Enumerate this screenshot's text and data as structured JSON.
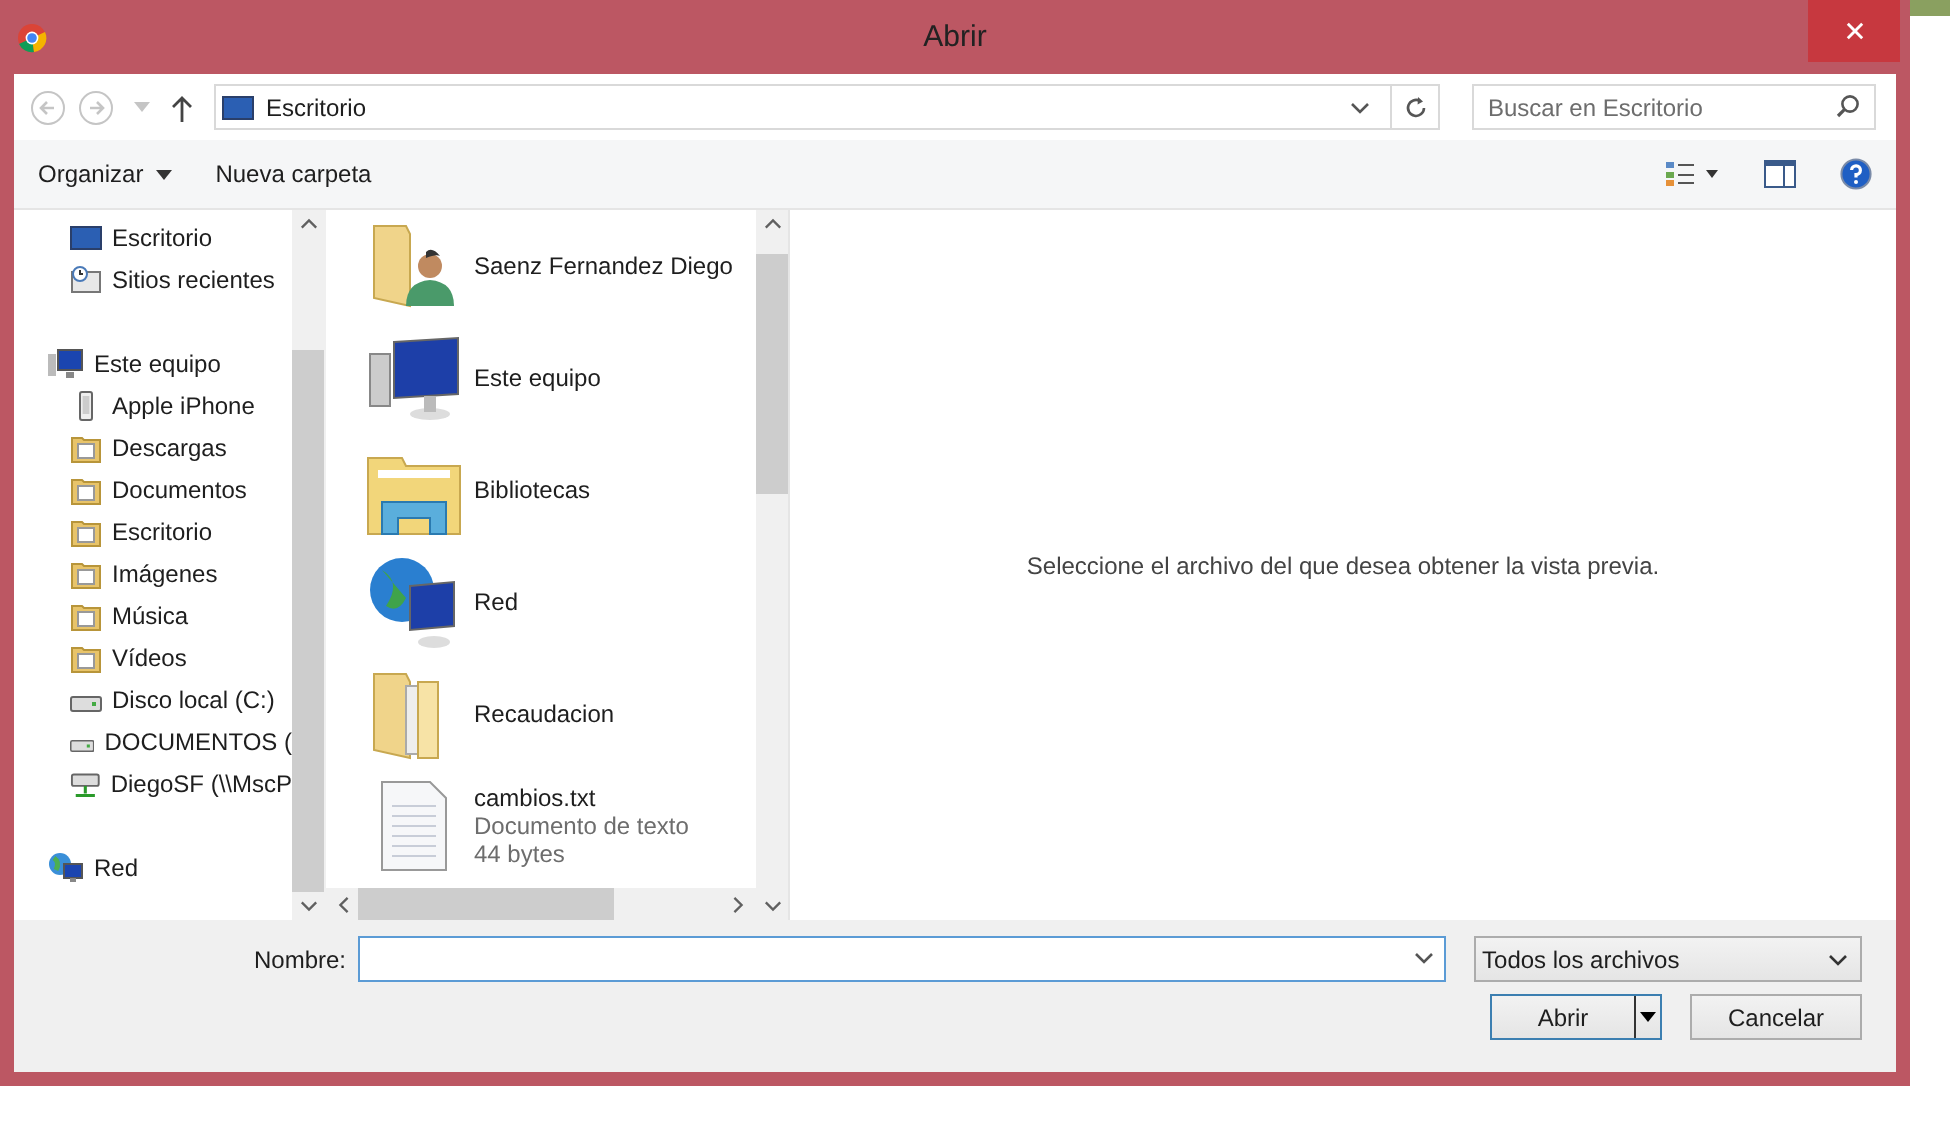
{
  "window": {
    "title": "Abrir"
  },
  "address": {
    "location": "Escritorio",
    "search_placeholder": "Buscar en Escritorio"
  },
  "toolbar": {
    "organize": "Organizar",
    "new_folder": "Nueva carpeta"
  },
  "nav": [
    {
      "label": "Escritorio",
      "kind": "monitor"
    },
    {
      "label": "Sitios recientes",
      "kind": "recent"
    },
    {
      "label": "Este equipo",
      "kind": "computer",
      "children": [
        {
          "label": "Apple iPhone",
          "kind": "phone"
        },
        {
          "label": "Descargas",
          "kind": "folder"
        },
        {
          "label": "Documentos",
          "kind": "folder"
        },
        {
          "label": "Escritorio",
          "kind": "folder"
        },
        {
          "label": "Imágenes",
          "kind": "folder"
        },
        {
          "label": "Música",
          "kind": "folder"
        },
        {
          "label": "Vídeos",
          "kind": "folder"
        },
        {
          "label": "Disco local (C:)",
          "kind": "drive"
        },
        {
          "label": "DOCUMENTOS (",
          "kind": "drive"
        },
        {
          "label": "DiegoSF (\\\\MscP",
          "kind": "netdrive"
        }
      ]
    },
    {
      "label": "Red",
      "kind": "network"
    }
  ],
  "files": [
    {
      "name": "Saenz Fernandez Diego",
      "kind": "userfolder"
    },
    {
      "name": "Este equipo",
      "kind": "computer"
    },
    {
      "name": "Bibliotecas",
      "kind": "library"
    },
    {
      "name": "Red",
      "kind": "network"
    },
    {
      "name": "Recaudacion",
      "kind": "folder"
    },
    {
      "name": "cambios.txt",
      "kind": "textfile",
      "details": [
        "Documento de texto",
        "44 bytes"
      ]
    }
  ],
  "preview": {
    "message": "Seleccione el archivo del que desea obtener la vista previa."
  },
  "footer": {
    "name_label": "Nombre:",
    "filter": "Todos los archivos",
    "open": "Abrir",
    "cancel": "Cancelar"
  }
}
